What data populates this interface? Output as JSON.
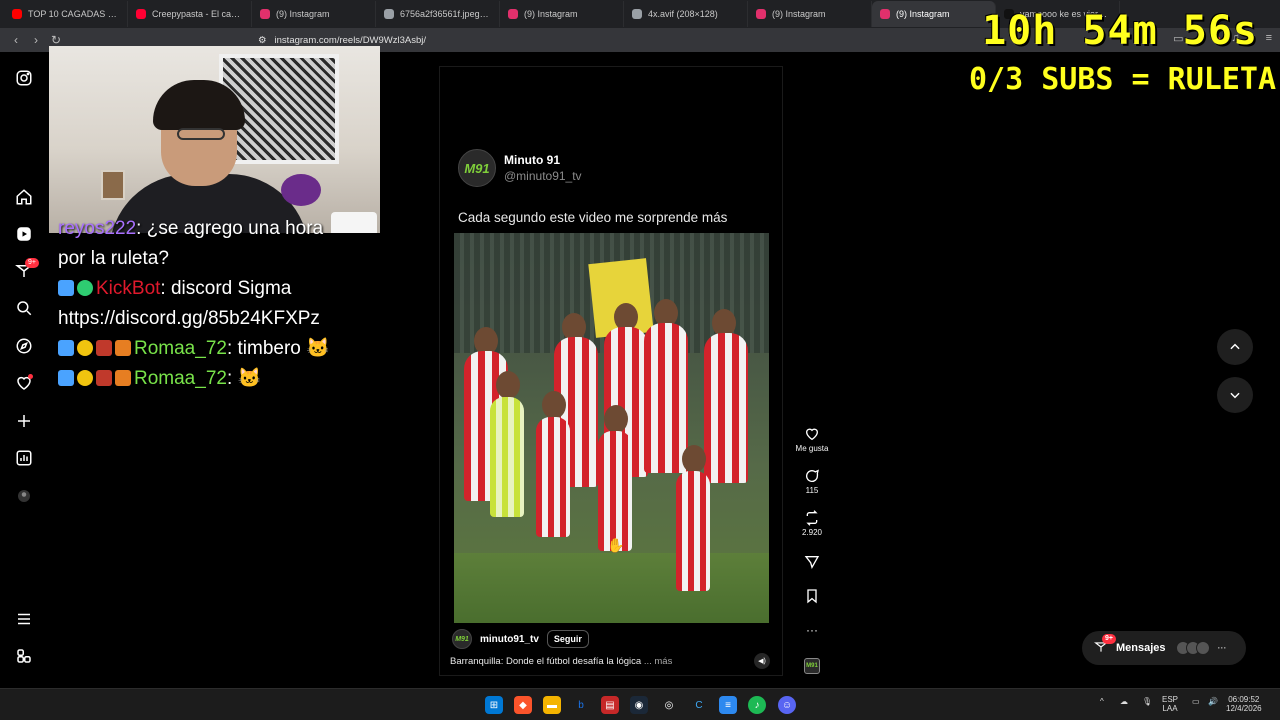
{
  "browser": {
    "tabs": [
      {
        "title": "TOP 10 CAGADAS DE OVE",
        "color": "#ff0000"
      },
      {
        "title": "Creepypasta - El capitulo",
        "color": "#ff0033"
      },
      {
        "title": "(9) Instagram",
        "color": "#e1306c"
      },
      {
        "title": "6756a2f36561f.jpeg (1080",
        "color": "#9aa0a6"
      },
      {
        "title": "(9) Instagram",
        "color": "#e1306c"
      },
      {
        "title": "4x.avif (208×128)",
        "color": "#9aa0a6"
      },
      {
        "title": "(9) Instagram",
        "color": "#e1306c"
      },
      {
        "title": "(9) Instagram",
        "color": "#e1306c",
        "active": true
      },
      {
        "title": "vamoooo ke es viernes el",
        "color": "#111111"
      }
    ],
    "url": "instagram.com/reels/DW9Wzl3Asbj/"
  },
  "overlay": {
    "timer": "10h 54m 56s",
    "subs": "0/3 SUBS = RULETA"
  },
  "sidebar": {
    "icons": [
      "instagram-logo-icon",
      "home-icon",
      "reels-icon",
      "direct-icon",
      "search-icon",
      "explore-icon",
      "heart-icon",
      "create-icon",
      "dashboard-icon",
      "profile-avatar-icon",
      "menu-icon",
      "meta-icon"
    ],
    "direct_badge": "9+"
  },
  "chat": {
    "lines": [
      {
        "user": "reyos222",
        "text": ": ¿se agrego una hora"
      },
      {
        "user": "",
        "text": "por la ruleta?"
      },
      {
        "user": "KickBot",
        "text": ": discord Sigma"
      },
      {
        "user": "",
        "text": "https://discord.gg/85b24KFXPz"
      },
      {
        "user": "Romaa_72",
        "text": ": timbero 🐱"
      },
      {
        "user": "Romaa_72",
        "text": ": 🐱"
      }
    ]
  },
  "reel": {
    "account_name": "Minuto 91",
    "account_handle": "@minuto91_tv",
    "avatar_text": "M91",
    "tweet_text": "Cada segundo este video me sorprende más",
    "username": "minuto91_tv",
    "follow_label": "Seguir",
    "caption": "Barranquilla: Donde el fútbol desafía la lógica",
    "caption_more": "... más"
  },
  "actions": {
    "like_label": "Me gusta",
    "comments": "115",
    "reposts": "2.920"
  },
  "messages": {
    "label": "Mensajes",
    "badge": "9+"
  },
  "taskbar": {
    "lang_top": "ESP",
    "lang_bottom": "LAA",
    "time": "06:09:52",
    "date": "12/4/2026"
  }
}
